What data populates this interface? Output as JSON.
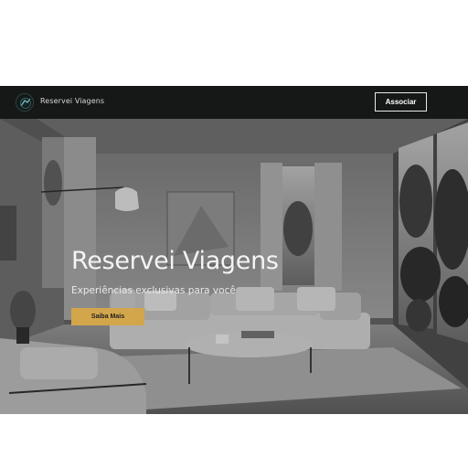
{
  "nav": {
    "brand": "Reservei Viagens",
    "join_label": "Associar",
    "logo_icon": "airplane-logo-icon"
  },
  "hero": {
    "title": "Reservei Viagens",
    "subtitle": "Experiências exclusivas para você",
    "cta_label": "Saiba Mais",
    "background_image": "living-room-interior-photo"
  },
  "colors": {
    "navbar_bg": "#161817",
    "cta_bg": "#d3a64b",
    "text_light": "#f4f4f4"
  }
}
